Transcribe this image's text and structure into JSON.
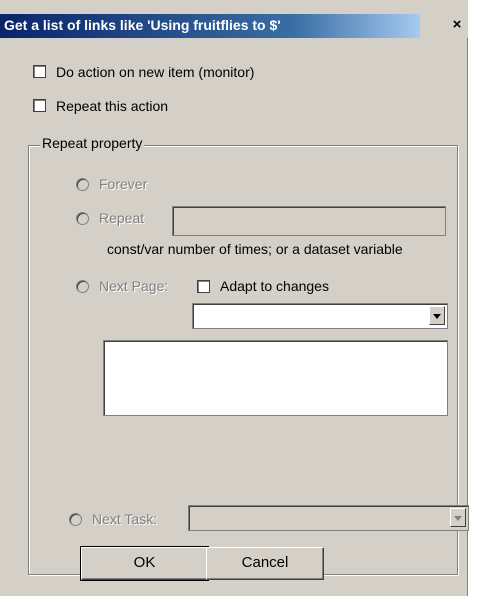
{
  "window": {
    "title": "Get a list of links like 'Using fruitflies to $'",
    "close_glyph": "×"
  },
  "options": {
    "do_action_label": "Do action on new item (monitor)",
    "repeat_action_label": "Repeat this action"
  },
  "repeat_group": {
    "legend": "Repeat property",
    "forever_label": "Forever",
    "repeat_label": "Repeat",
    "repeat_value": "",
    "repeat_hint": "const/var number of times; or a dataset variable",
    "next_page_label": "Next Page:",
    "adapt_label": "Adapt to changes",
    "next_page_select_value": "",
    "next_page_text": "",
    "next_task_label": "Next Task:",
    "next_task_select_value": ""
  },
  "buttons": {
    "ok_label": "OK",
    "cancel_label": "Cancel"
  }
}
